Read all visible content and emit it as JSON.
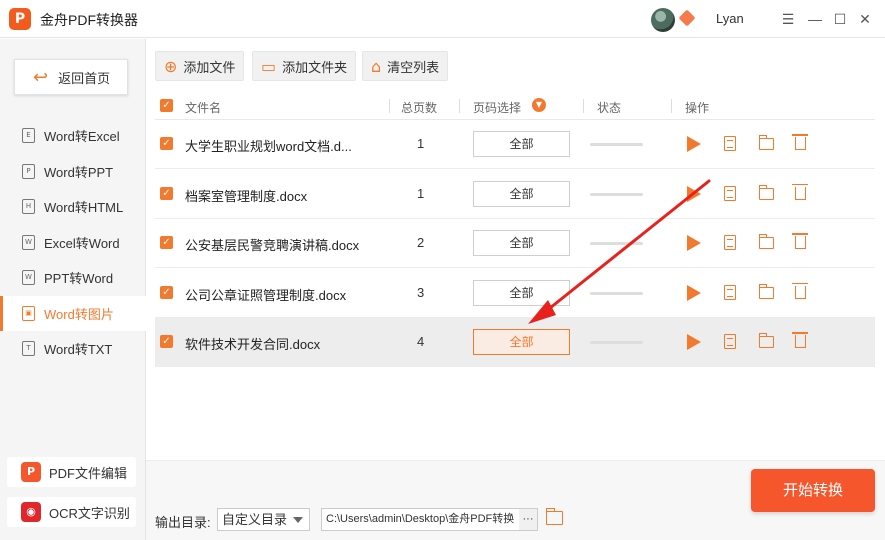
{
  "app": {
    "logo_letter": "P",
    "title": "金舟PDF转换器",
    "username": "Lyan",
    "window_controls": {
      "menu": "☰",
      "minimize": "—",
      "maximize": "☐",
      "close": "✕"
    }
  },
  "sidebar": {
    "home_label": "返回首页",
    "items": [
      {
        "label": "Word转Excel",
        "icon": "document-icon",
        "glyph": "E",
        "active": false
      },
      {
        "label": "Word转PPT",
        "icon": "document-icon",
        "glyph": "P",
        "active": false
      },
      {
        "label": "Word转HTML",
        "icon": "document-icon",
        "glyph": "H",
        "active": false
      },
      {
        "label": "Excel转Word",
        "icon": "document-icon",
        "glyph": "W",
        "active": false
      },
      {
        "label": "PPT转Word",
        "icon": "document-icon",
        "glyph": "W",
        "active": false
      },
      {
        "label": "Word转图片",
        "icon": "image-icon",
        "glyph": "▣",
        "active": true
      },
      {
        "label": "Word转TXT",
        "icon": "document-icon",
        "glyph": "T",
        "active": false
      }
    ],
    "tools": [
      {
        "label": "PDF文件编辑",
        "glyph": "P",
        "color": "#f5562c"
      },
      {
        "label": "OCR文字识别",
        "glyph": "◉",
        "color": "#e0282c"
      }
    ]
  },
  "toolbar": {
    "add_file": "添加文件",
    "add_folder": "添加文件夹",
    "clear_list": "清空列表"
  },
  "table": {
    "headers": {
      "name": "文件名",
      "pages": "总页数",
      "range": "页码选择",
      "status": "状态",
      "actions": "操作"
    },
    "rows": [
      {
        "name": "大学生职业规划word文档.d...",
        "pages": "1",
        "range": "全部",
        "selected": false
      },
      {
        "name": "档案室管理制度.docx",
        "pages": "1",
        "range": "全部",
        "selected": false
      },
      {
        "name": "公安基层民警竞聘演讲稿.docx",
        "pages": "2",
        "range": "全部",
        "selected": false
      },
      {
        "name": "公司公章证照管理制度.docx",
        "pages": "3",
        "range": "全部",
        "selected": false
      },
      {
        "name": "软件技术开发合同.docx",
        "pages": "4",
        "range": "全部",
        "selected": true
      }
    ]
  },
  "footer": {
    "output_label": "输出目录:",
    "output_mode": "自定义目录",
    "output_path": "C:\\Users\\admin\\Desktop\\金舟PDF转换",
    "browse": "···",
    "start_label": "开始转换"
  },
  "colors": {
    "accent": "#f27a2e",
    "start_button": "#f5562c",
    "annotation_arrow": "#e8211c"
  }
}
